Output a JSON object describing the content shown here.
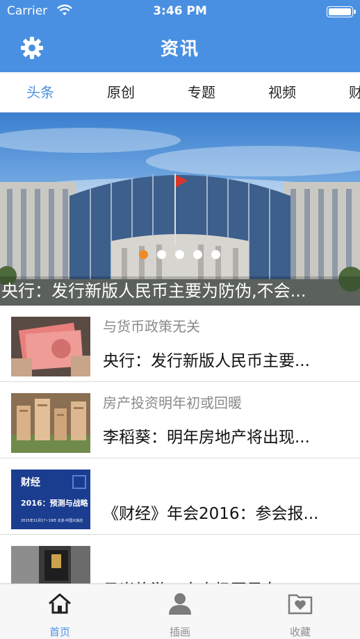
{
  "status_bar": {
    "carrier": "Carrier",
    "time": "3:46 PM"
  },
  "nav": {
    "title": "资讯",
    "settings_icon": "gear-icon"
  },
  "tabs": [
    {
      "label": "头条",
      "active": true
    },
    {
      "label": "原创",
      "active": false
    },
    {
      "label": "专题",
      "active": false
    },
    {
      "label": "视频",
      "active": false
    },
    {
      "label": "财",
      "active": false
    }
  ],
  "banner": {
    "caption": "央行：发行新版人民币主要为防伪,不会...",
    "page_count": 5,
    "current_page": 1
  },
  "news": [
    {
      "subtitle": "与货币政策无关",
      "title": "央行：发行新版人民币主要..."
    },
    {
      "subtitle": "房产投资明年初或回暖",
      "title": "李稻葵：明年房地产将出现..."
    },
    {
      "subtitle": "",
      "title": "《财经》年会2016：参会报...",
      "thumb_text": {
        "brand": "财经",
        "headline": "2016：预测与战略",
        "date": "2015年11月17~19日  北京·中国大饭店"
      }
    },
    {
      "subtitle": "",
      "title": "日光旅游，大太极国风女..."
    }
  ],
  "tabbar": [
    {
      "label": "首页",
      "icon": "home-icon",
      "active": true
    },
    {
      "label": "插画",
      "icon": "person-icon",
      "active": false
    },
    {
      "label": "收藏",
      "icon": "heart-folder-icon",
      "active": false
    }
  ],
  "colors": {
    "accent": "#4a90e2",
    "active_dot": "#f08a24"
  }
}
